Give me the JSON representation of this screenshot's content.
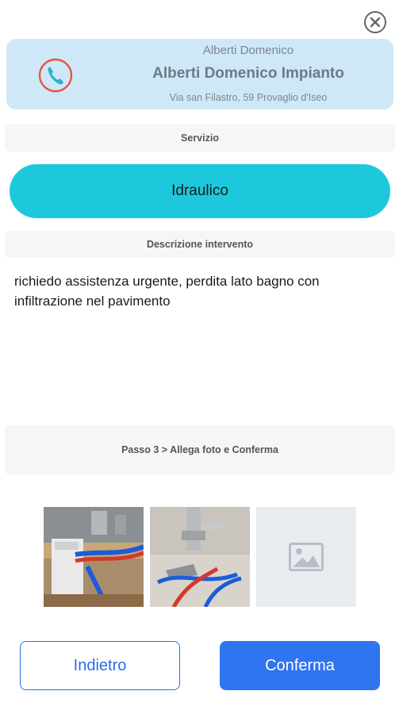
{
  "provider": {
    "name_small": "Alberti Domenico",
    "name": "Alberti Domenico Impianto",
    "address": "Via san Filastro, 59 Provaglio d'Iseo"
  },
  "service": {
    "label": "Servizio",
    "selected": "Idraulico"
  },
  "description": {
    "label": "Descrizione intervento",
    "text": "richiedo assistenza urgente, perdita lato bagno con infiltrazione nel pavimento"
  },
  "step": {
    "label": "Passo 3 > Allega foto e Conferma"
  },
  "photos": {
    "add_icon": "image-placeholder-icon"
  },
  "actions": {
    "back_label": "Indietro",
    "confirm_label": "Conferma"
  },
  "colors": {
    "card_bg": "#cfe8f8",
    "service_pill": "#1ec8dc",
    "primary": "#2f74f0",
    "phone_icon": "#e8553d",
    "phone_handset": "#2ab3c7"
  }
}
